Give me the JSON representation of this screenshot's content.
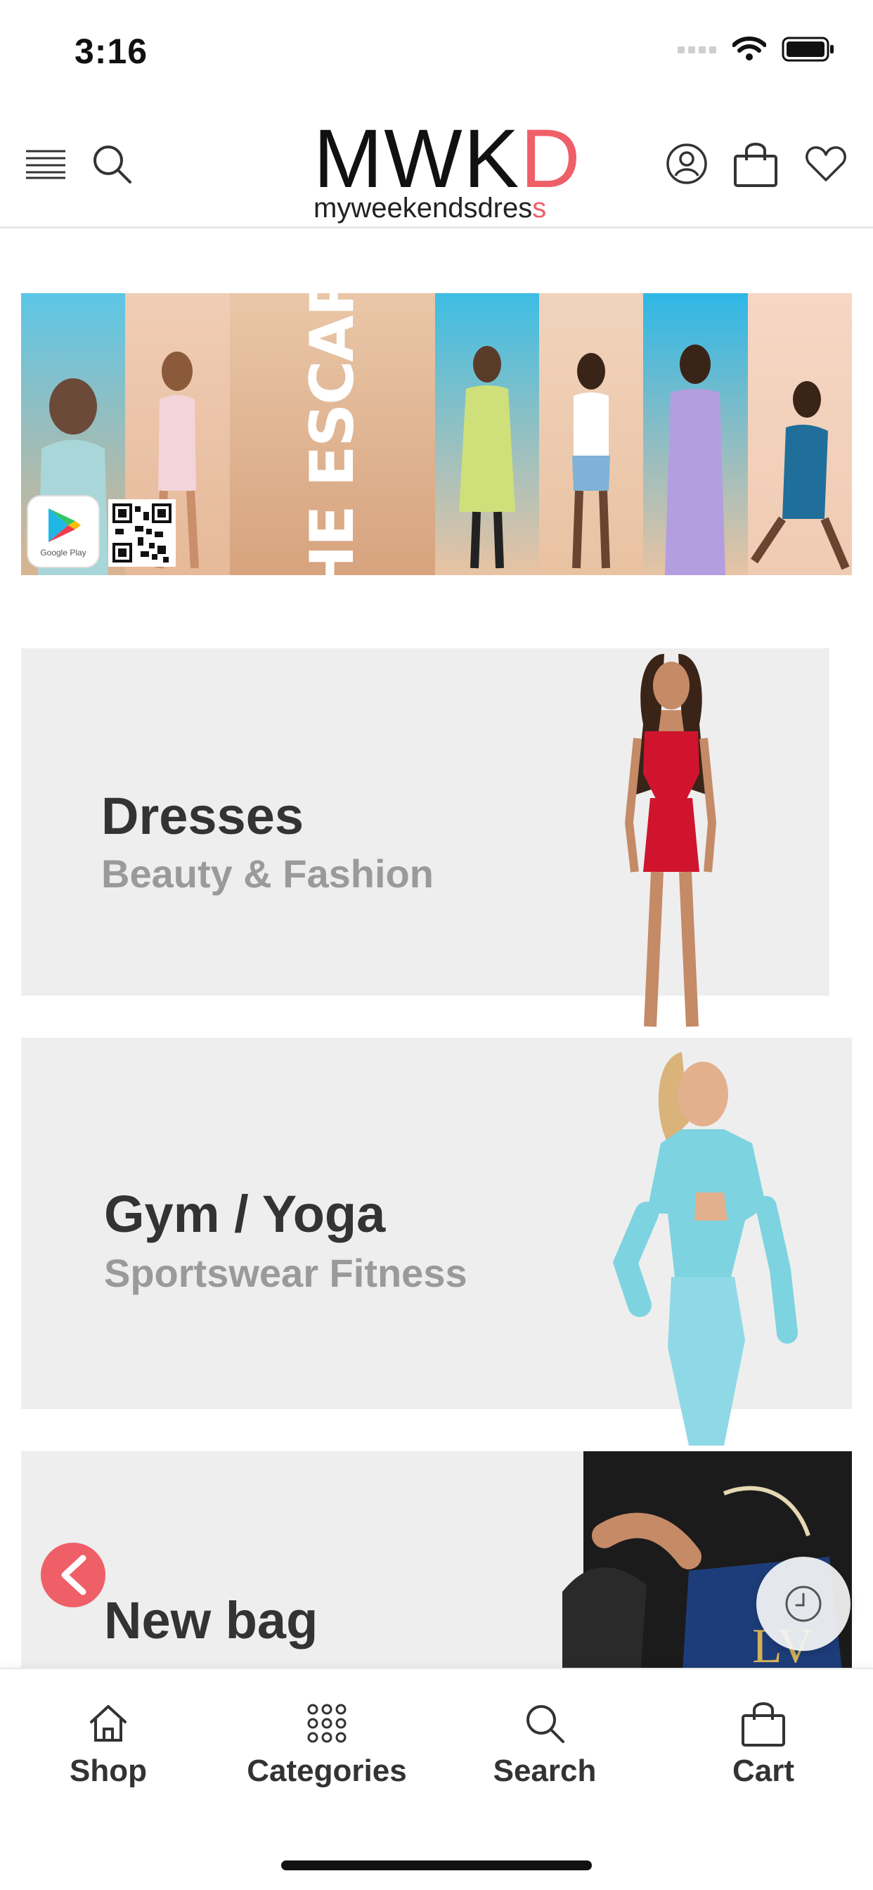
{
  "status_bar": {
    "time": "3:16"
  },
  "header": {
    "logo_main_left": "MWK",
    "logo_main_accent": "D",
    "logo_sub_left": "myweekendsdres",
    "logo_sub_accent": "s",
    "menu_icon": "hamburger-menu-icon",
    "search_icon": "search-icon",
    "account_icon": "user-icon",
    "bag_icon": "shopping-bag-icon",
    "wishlist_icon": "heart-icon"
  },
  "banner": {
    "headline": "THE ESCAPE",
    "store_badge_label": "Google Play"
  },
  "categories": [
    {
      "title": "Dresses",
      "subtitle": "Beauty & Fashion"
    },
    {
      "title": "Gym / Yoga",
      "subtitle": "Sportswear Fitness"
    },
    {
      "title": "New bag",
      "subtitle": ""
    }
  ],
  "bottom_nav": {
    "items": [
      {
        "label": "Shop",
        "icon": "home-icon"
      },
      {
        "label": "Categories",
        "icon": "grid-dots-icon"
      },
      {
        "label": "Search",
        "icon": "search-icon"
      },
      {
        "label": "Cart",
        "icon": "shopping-bag-icon"
      }
    ]
  },
  "colors": {
    "accent": "#ef5f68",
    "card_bg": "#eeeeee",
    "text_dark": "#333333",
    "text_muted": "#9a9a9a"
  }
}
